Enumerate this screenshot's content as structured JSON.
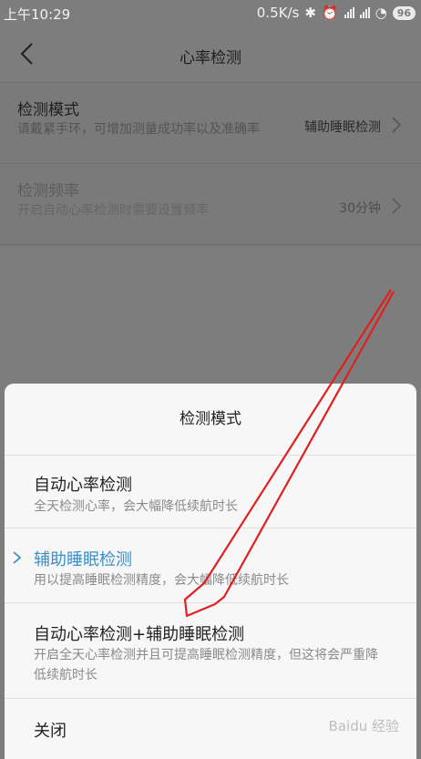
{
  "status": {
    "time": "上午10:29",
    "speed": "0.5K/s",
    "battery": "96"
  },
  "nav": {
    "title": "心率检测"
  },
  "settings": [
    {
      "title": "检测模式",
      "subtitle": "请戴紧手环，可增加测量成功率以及准确率",
      "value": "辅助睡眠检测"
    },
    {
      "title": "检测频率",
      "subtitle": "开启自动心率检测时需要设置频率",
      "value": "30分钟"
    }
  ],
  "sheet": {
    "title": "检测模式",
    "options": [
      {
        "title": "自动心率检测",
        "desc": "全天检测心率，会大幅降低续航时长",
        "selected": false
      },
      {
        "title": "辅助睡眠检测",
        "desc": "用以提高睡眠检测精度，会大幅降低续航时长",
        "selected": true
      },
      {
        "title": "自动心率检测+辅助睡眠检测",
        "desc": "开启全天心率检测并且可提高睡眠检测精度，但这将会严重降低续航时长",
        "selected": false
      }
    ],
    "close_label": "关闭"
  },
  "watermark": "Baidu 经验",
  "colors": {
    "accent": "#3a8fc8",
    "arrow": "#e0201f",
    "overlay": "#7d7d7d"
  }
}
